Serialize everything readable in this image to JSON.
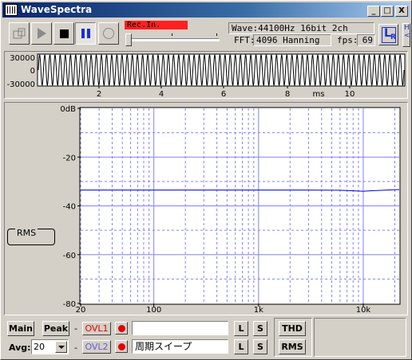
{
  "window": {
    "title": "WaveSpectra",
    "controls": {
      "minimize": "_",
      "maximize": "□",
      "close": "X"
    }
  },
  "toolbar": {
    "rec_in_label": "Rec.In.",
    "wave_format": "Wave:44100Hz 16bit 2ch",
    "fft_label": "FFT:",
    "fft_value": "4096 Hanning",
    "fps_label": "fps:",
    "fps_value": "69",
    "channel_icon_label": "L",
    "channel_icon_sub": "R",
    "side_tab_letters": [
      "H",
      "<"
    ]
  },
  "waveform": {
    "y_ticks": [
      "30000",
      "0",
      "-30000"
    ],
    "x_ticks": [
      "2",
      "4",
      "6",
      "8",
      "10"
    ],
    "x_unit": "ms"
  },
  "spectrum": {
    "mode_label": "RMS",
    "y_ticks": [
      "0dB",
      "-20",
      "-40",
      "-60",
      "-80"
    ],
    "x_ticks": [
      "20",
      "100",
      "1k",
      "10k"
    ],
    "line_color": "#0000cc",
    "grid_color": "#8080ff"
  },
  "bottom": {
    "main_label": "Main",
    "peak_label": "Peak",
    "dash": "-",
    "avg_label": "Avg:",
    "avg_value": "20",
    "ovl1_label": "OVL1",
    "ovl2_label": "OVL2",
    "text1_value": "",
    "text2_value": "周期スイープ",
    "l_label": "L",
    "s_label": "S",
    "thd_label": "THD",
    "rms_label": "RMS",
    "ovl1_color": "#e00000",
    "ovl2_color": "#6060d0"
  },
  "chart_data": {
    "type": "line",
    "x_scale": "log",
    "x_range": [
      20,
      22050
    ],
    "y_range": [
      -80,
      0
    ],
    "ylabel": "",
    "xlabel": "",
    "x": [
      20,
      100,
      1000,
      2800,
      6000,
      10000,
      12000,
      22050
    ],
    "y": [
      -33.5,
      -33.5,
      -33.5,
      -33.5,
      -33.6,
      -34.0,
      -33.8,
      -33.3
    ]
  }
}
